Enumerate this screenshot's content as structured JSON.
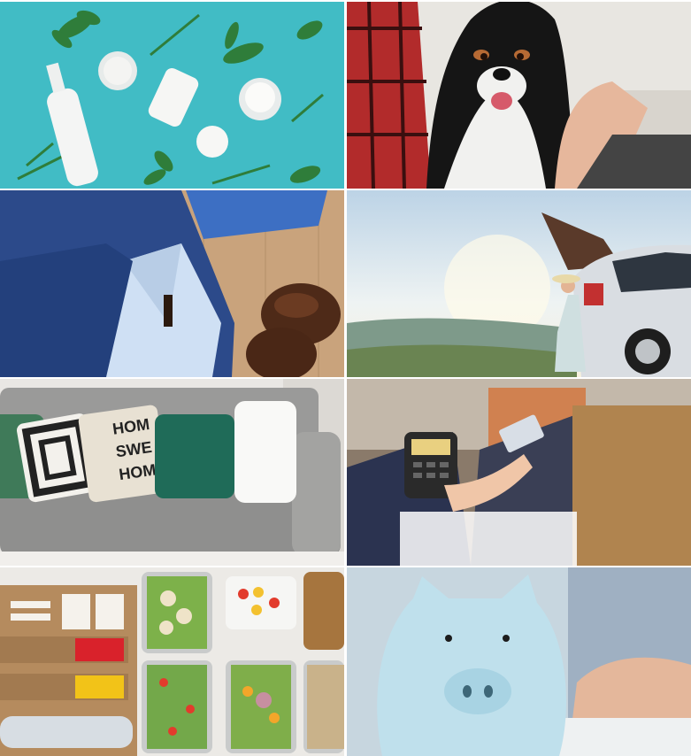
{
  "tiles": [
    {
      "subject": "skincare-products",
      "icon": "lotion-bottles-leaves",
      "bg": "#41bcc5"
    },
    {
      "subject": "dog-with-owner",
      "icon": "dog",
      "bg": "#e8e6e1"
    },
    {
      "subject": "menswear",
      "icon": "suit-shirt-shoes",
      "bg": "#c9a37c"
    },
    {
      "subject": "car-travel",
      "icon": "car-landscape",
      "bg": "#cfe0ee"
    },
    {
      "subject": "home-furnishing",
      "icon": "sofa-cushions",
      "bg": "#e9e7e4"
    },
    {
      "subject": "retail-payment",
      "icon": "card-terminal",
      "bg": "#8a7a6a"
    },
    {
      "subject": "meal-delivery",
      "icon": "food-containers",
      "bg": "#eceae6"
    },
    {
      "subject": "savings",
      "icon": "piggy-bank",
      "bg": "#c7d6df"
    }
  ],
  "cushion_text": [
    "HOM",
    "SWE",
    "HOM"
  ],
  "colors": {
    "teal": "#41bcc5",
    "sofa": "#8f8f8e",
    "suit": "#2c4a8a",
    "piggy": "#bfe0ec"
  }
}
